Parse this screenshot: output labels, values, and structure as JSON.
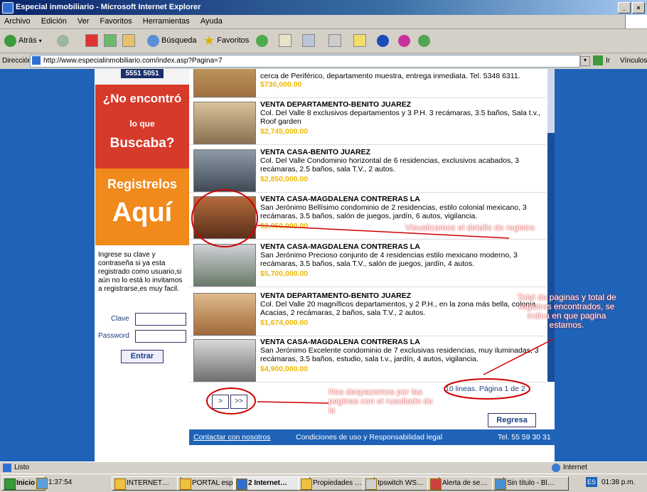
{
  "window": {
    "title": "Especial inmobiliario - Microsoft Internet Explorer",
    "controls": [
      "_",
      "×"
    ]
  },
  "menu": [
    "Archivo",
    "Edición",
    "Ver",
    "Favoritos",
    "Herramientas",
    "Ayuda"
  ],
  "toolbar": {
    "back": "Atrás",
    "search": "Búsqueda",
    "favorites": "Favoritos"
  },
  "address": {
    "label": "Dirección",
    "url": "http://www.especialinmobiliario.com/index.asp?Pagina=7",
    "go": "Ir",
    "links": "Vínculos"
  },
  "left": {
    "phone_fragment": "5551 5051",
    "promo1": "¿No encontró",
    "promo2": "lo que",
    "promo3": "Buscaba?",
    "promo4": "Registrelos",
    "promo5": "Aquí",
    "login_text": "Ingrese su clave y contraseña si ya esta registrado como usuario,si aún no lo está lo invitamos a registrarse,es muy facil.",
    "clave_label": "Clave",
    "password_label": "Password",
    "enter_button": "Entrar"
  },
  "listings": [
    {
      "title": "",
      "desc": "cerca de Periférico, departamento muestra, entrega inmediata. Tel. 5348 6311.",
      "price": "$730,000.00"
    },
    {
      "title": "VENTA DEPARTAMENTO-BENITO JUAREZ",
      "desc": "Col. Del Valle 8 exclusivos departamentos y 3 P.H. 3 recámaras, 3.5 baños, Sala t.v., Roof garden",
      "price": "$2,745,000.00"
    },
    {
      "title": "VENTA CASA-BENITO JUAREZ",
      "desc": "Col. Del Valle Condominio horizontal de 6 residencias, exclusivos acabados, 3 recámaras, 2.5 baños, sala T.V., 2 autos.",
      "price": "$2,850,000.00"
    },
    {
      "title": "VENTA CASA-MAGDALENA CONTRERAS LA",
      "desc": "San Jerónimo Bellísimo condominio de 2 residencias, estilo colonial mexicano, 3 recámaras, 3.5 baños, salón de juegos, jardín, 6 autos, vigilancia.",
      "price": "$2,950,000.00"
    },
    {
      "title": "VENTA CASA-MAGDALENA CONTRERAS LA",
      "desc": "San Jerónimo Precioso conjunto de 4 residencias estilo mexicano moderno, 3 recámaras, 3.5 baños, sala T.V., salón de juegos, jardín, 4 autos.",
      "price": "$5,700,000.00"
    },
    {
      "title": "VENTA DEPARTAMENTO-BENITO JUAREZ",
      "desc": "Col. Del Valle 20 magníficos departamentos, y 2 P.H., en la zona más bella, colonia Acacias, 2 recámaras, 2 baños, sala T.V., 2 autos.",
      "price": "$1,674,000.00"
    },
    {
      "title": "VENTA CASA-MAGDALENA CONTRERAS LA",
      "desc": "San Jerónimo Excelente condominio de 7 exclusivas residencias, muy iluminadas, 3 recámaras, 3.5 baños, estudio, sala t.v., jardín, 4 autos, vigilancia.",
      "price": "$4,900,000.00"
    }
  ],
  "pagination": {
    "next": ">",
    "last": ">>",
    "summary": "10 lineas. Página 1 de 2"
  },
  "back_button": "Regresa",
  "footer": {
    "contact": "Contactar con nosotros",
    "terms": "Condiciones de uso y Responsabilidad legal",
    "phone": "Tel. 55 59 30 31"
  },
  "annotations": {
    "detail": "Visualizamos el detalle de registro",
    "totals": "Total de paginas y total de registros encontrados, se indica en que pagina estamos.",
    "navigate": "Nos despazemos por las paginas con el rusultado de la"
  },
  "status": {
    "left": "Listo",
    "zone": "Internet"
  },
  "taskbar": {
    "start": "Inicio",
    "tray_left": "1:37:54",
    "tasks": [
      "INTERNET…",
      "PORTAL esp…",
      "2 Internet…",
      "Propiedades …",
      "Ipswitch WS…",
      "Alerta de se…",
      "Sin título - Bl…"
    ],
    "lang": "ES",
    "clock": "01:38 p.m."
  },
  "colors": {
    "page_bg": "#1e63b8",
    "promo_red": "#d63a2a",
    "promo_orange": "#f08a1c",
    "price": "#f0b800",
    "annotation_red": "#d00000"
  }
}
